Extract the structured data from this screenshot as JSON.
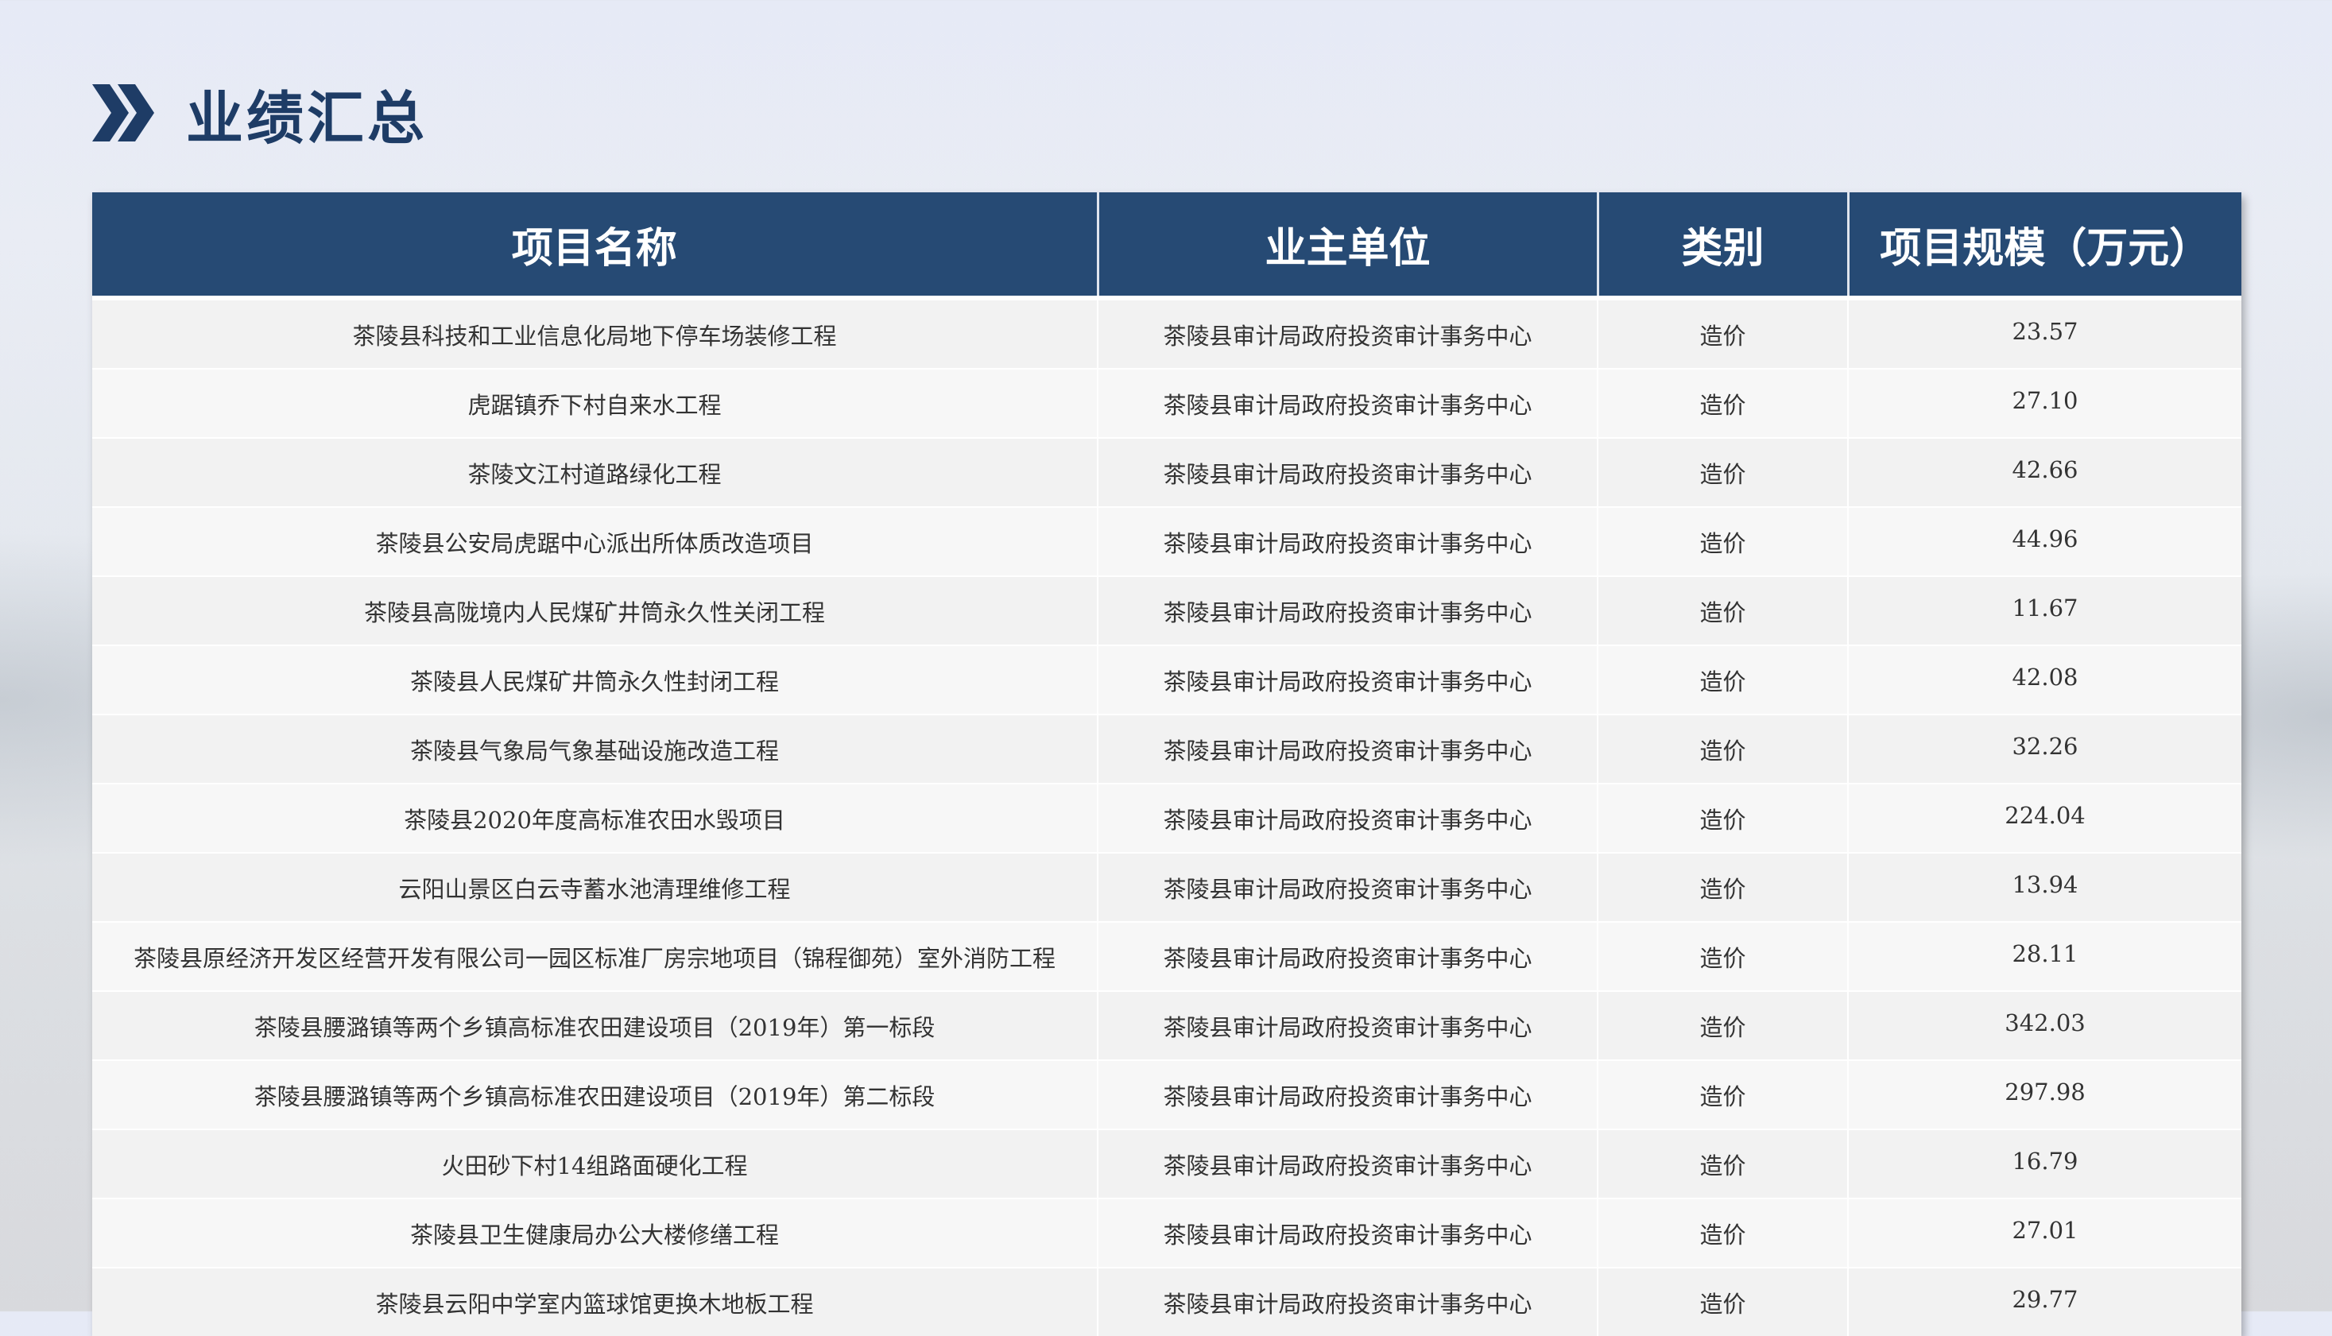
{
  "page": {
    "title": "业绩汇总",
    "accent_color": "#264a74",
    "title_color": "#1e3c66",
    "icon": "double-chevron-right-icon"
  },
  "table": {
    "headers": [
      "项目名称",
      "业主单位",
      "类别",
      "项目规模（万元）"
    ],
    "rows": [
      [
        "茶陵县科技和工业信息化局地下停车场装修工程",
        "茶陵县审计局政府投资审计事务中心",
        "造价",
        "23.57"
      ],
      [
        "虎踞镇乔下村自来水工程",
        "茶陵县审计局政府投资审计事务中心",
        "造价",
        "27.10"
      ],
      [
        "茶陵文江村道路绿化工程",
        "茶陵县审计局政府投资审计事务中心",
        "造价",
        "42.66"
      ],
      [
        "茶陵县公安局虎踞中心派出所体质改造项目",
        "茶陵县审计局政府投资审计事务中心",
        "造价",
        "44.96"
      ],
      [
        "茶陵县高陇境内人民煤矿井筒永久性关闭工程",
        "茶陵县审计局政府投资审计事务中心",
        "造价",
        "11.67"
      ],
      [
        "茶陵县人民煤矿井筒永久性封闭工程",
        "茶陵县审计局政府投资审计事务中心",
        "造价",
        "42.08"
      ],
      [
        "茶陵县气象局气象基础设施改造工程",
        "茶陵县审计局政府投资审计事务中心",
        "造价",
        "32.26"
      ],
      [
        "茶陵县2020年度高标准农田水毁项目",
        "茶陵县审计局政府投资审计事务中心",
        "造价",
        "224.04"
      ],
      [
        "云阳山景区白云寺蓄水池清理维修工程",
        "茶陵县审计局政府投资审计事务中心",
        "造价",
        "13.94"
      ],
      [
        "茶陵县原经济开发区经营开发有限公司一园区标准厂房宗地项目（锦程御苑）室外消防工程",
        "茶陵县审计局政府投资审计事务中心",
        "造价",
        "28.11"
      ],
      [
        "茶陵县腰潞镇等两个乡镇高标准农田建设项目（2019年）第一标段",
        "茶陵县审计局政府投资审计事务中心",
        "造价",
        "342.03"
      ],
      [
        "茶陵县腰潞镇等两个乡镇高标准农田建设项目（2019年）第二标段",
        "茶陵县审计局政府投资审计事务中心",
        "造价",
        "297.98"
      ],
      [
        "火田砂下村14组路面硬化工程",
        "茶陵县审计局政府投资审计事务中心",
        "造价",
        "16.79"
      ],
      [
        "茶陵县卫生健康局办公大楼修缮工程",
        "茶陵县审计局政府投资审计事务中心",
        "造价",
        "27.01"
      ],
      [
        "茶陵县云阳中学室内篮球馆更换木地板工程",
        "茶陵县审计局政府投资审计事务中心",
        "造价",
        "29.77"
      ]
    ]
  }
}
